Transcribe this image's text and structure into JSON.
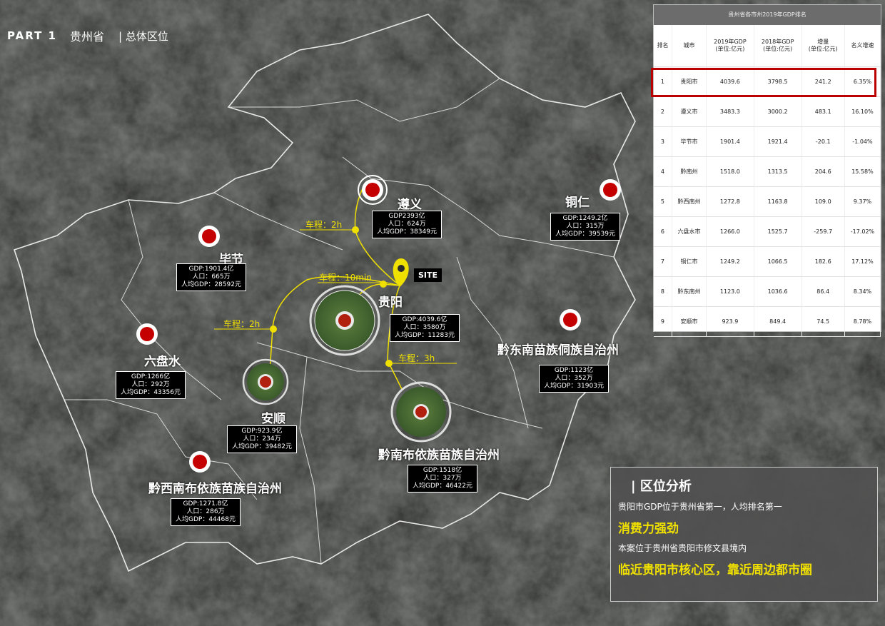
{
  "header": {
    "part": "PART 1",
    "province": "贵州省",
    "section": "| 总体区位"
  },
  "cities": [
    {
      "key": "zunyi",
      "name": "遵义",
      "gdp": "GDP2393亿",
      "pop": "人口：624万",
      "pc": "人均GDP：38349元"
    },
    {
      "key": "tongren",
      "name": "铜仁",
      "gdp": "GDP:1249.2亿",
      "pop": "人口：315万",
      "pc": "人均GDP：39539元"
    },
    {
      "key": "bijie",
      "name": "毕节",
      "gdp": "GDP:1901.4亿",
      "pop": "人口：665万",
      "pc": "人均GDP：28592元"
    },
    {
      "key": "guiyang",
      "name": "贵阳",
      "gdp": "GDP:4039.6亿",
      "pop": "人口：3580万",
      "pc": "人均GDP：11283元"
    },
    {
      "key": "liupanshui",
      "name": "六盘水",
      "gdp": "GDP:1266亿",
      "pop": "人口：292万",
      "pc": "人均GDP：43356元"
    },
    {
      "key": "anshun",
      "name": "安顺",
      "gdp": "GDP:923.9亿",
      "pop": "人口：234万",
      "pc": "人均GDP：39482元"
    },
    {
      "key": "qiannan",
      "name": "黔南布依族苗族自治州",
      "gdp": "GDP:1518亿",
      "pop": "人口：327万",
      "pc": "人均GDP：46422元"
    },
    {
      "key": "qiandongnan",
      "name": "黔东南苗族侗族自治州",
      "gdp": "GDP:1123亿",
      "pop": "人口：352万",
      "pc": "人均GDP：31903元"
    },
    {
      "key": "qianxinan",
      "name": "黔西南布依族苗族自治州",
      "gdp": "GDP:1271.8亿",
      "pop": "人口：286万",
      "pc": "人均GDP：44468元"
    }
  ],
  "drive": {
    "zunyi": "车程：2h",
    "guiyang": "车程：10min",
    "anshun": "车程：2h",
    "qiannan": "车程：3h"
  },
  "site_label": "SITE",
  "ranking": {
    "title": "贵州省各市州2019年GDP排名",
    "headers": [
      "排名",
      "城市",
      "2019年GDP\n(单位:亿元)",
      "2018年GDP\n(单位:亿元)",
      "增量\n(单位:亿元)",
      "名义增速"
    ],
    "rows": [
      [
        "1",
        "贵阳市",
        "4039.6",
        "3798.5",
        "241.2",
        "6.35%"
      ],
      [
        "2",
        "遵义市",
        "3483.3",
        "3000.2",
        "483.1",
        "16.10%"
      ],
      [
        "3",
        "毕节市",
        "1901.4",
        "1921.4",
        "-20.1",
        "-1.04%"
      ],
      [
        "4",
        "黔南州",
        "1518.0",
        "1313.5",
        "204.6",
        "15.58%"
      ],
      [
        "5",
        "黔西南州",
        "1272.8",
        "1163.8",
        "109.0",
        "9.37%"
      ],
      [
        "6",
        "六盘水市",
        "1266.0",
        "1525.7",
        "-259.7",
        "-17.02%"
      ],
      [
        "7",
        "铜仁市",
        "1249.2",
        "1066.5",
        "182.6",
        "17.12%"
      ],
      [
        "8",
        "黔东南州",
        "1123.0",
        "1036.6",
        "86.4",
        "8.34%"
      ],
      [
        "9",
        "安顺市",
        "923.9",
        "849.4",
        "74.5",
        "8.78%"
      ]
    ]
  },
  "analysis": {
    "title": "| 区位分析",
    "line1": "贵阳市GDP位于贵州省第一，人均排名第一",
    "hl1": "消费力强劲",
    "line2": "本案位于贵州省贵阳市修文县境内",
    "hl2": "临近贵阳市核心区，靠近周边都市圈"
  },
  "colors": {
    "accent_yellow": "#f0e000",
    "marker_red": "#c40000",
    "highlight_red": "#b00000"
  }
}
